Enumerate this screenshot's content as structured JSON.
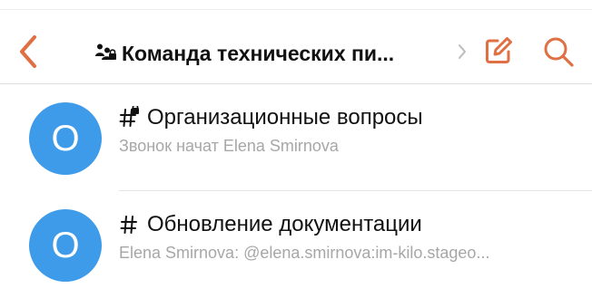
{
  "colors": {
    "accent": "#e06f43",
    "avatar": "#3d9be9",
    "title": "#111111",
    "subtitle": "#a7a7a7"
  },
  "header": {
    "title": "Команда технических пи...",
    "back_icon": "chevron-left-icon",
    "group_icon": "group-lock-icon",
    "compose_icon": "compose-icon",
    "search_icon": "search-icon"
  },
  "channels": [
    {
      "avatar_text": "O",
      "title": "Организационные вопросы",
      "subtitle": "Звонок начат Elena Smirnova",
      "icon": "private-hash-icon"
    },
    {
      "avatar_text": "O",
      "title": "Обновление документации",
      "subtitle": "Elena Smirnova: @elena.smirnova:im-kilo.stageo...",
      "icon": "hash-icon"
    }
  ]
}
